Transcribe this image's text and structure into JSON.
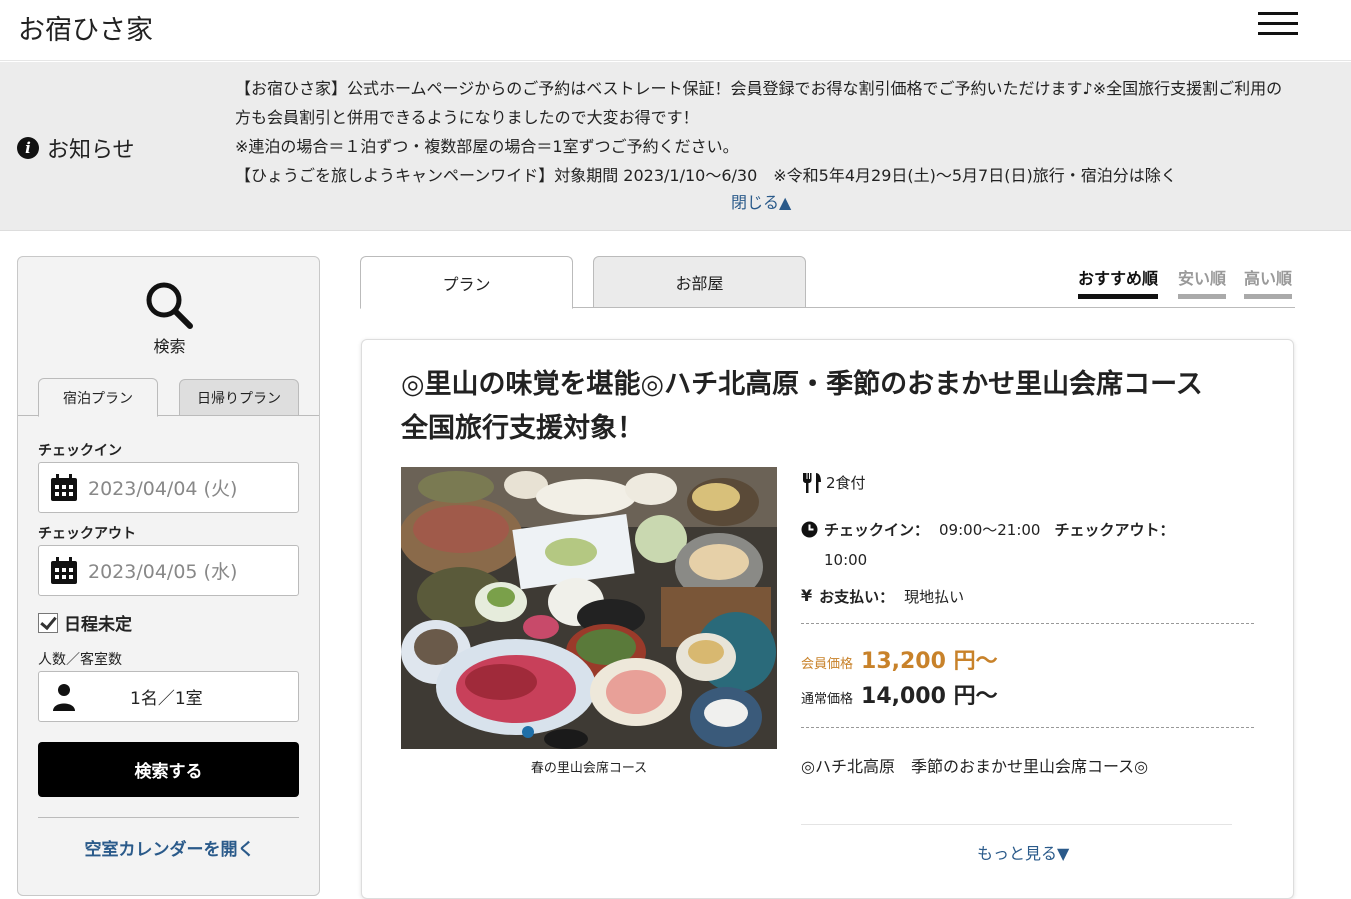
{
  "header": {
    "site_title": "お宿ひさ家",
    "menu_icon": "hamburger-menu-icon"
  },
  "notice": {
    "label": "お知らせ",
    "icon": "info-icon",
    "lines": [
      "【お宿ひさ家】公式ホームページからのご予約はベストレート保証！会員登録でお得な割引価格でご予約いただけます♪※全国旅行支援割ご利用の方も会員割引と併用できるようになりましたので大変お得です！",
      "※連泊の場合＝１泊ずつ・複数部屋の場合＝1室ずつご予約ください。",
      "【ひょうごを旅しようキャンペーンワイド】対象期間 2023/1/10～6/30　※令和5年4月29日(土)～5月7日(日)旅行・宿泊分は除く"
    ],
    "close_label": "閉じる▲"
  },
  "search": {
    "icon": "search-icon",
    "label": "検索",
    "tabs": [
      {
        "label": "宿泊プラン",
        "active": true
      },
      {
        "label": "日帰りプラン",
        "active": false
      }
    ],
    "checkin_label": "チェックイン",
    "checkin_value": "2023/04/04 (火)",
    "checkout_label": "チェックアウト",
    "checkout_value": "2023/04/05 (水)",
    "undecided_label": "日程未定",
    "undecided_checked": true,
    "guests_label": "人数／客室数",
    "guests_value": "1名／1室",
    "submit_label": "検索する",
    "calendar_link": "空室カレンダーを開く"
  },
  "main": {
    "tabs": [
      {
        "label": "プラン",
        "active": true
      },
      {
        "label": "お部屋",
        "active": false
      }
    ],
    "sort": [
      {
        "label": "おすすめ順",
        "active": true
      },
      {
        "label": "安い順",
        "active": false
      },
      {
        "label": "高い順",
        "active": false
      }
    ]
  },
  "plan": {
    "title": "◎里山の味覚を堪能◎ハチ北高原・季節のおまかせ里山会席コース　全国旅行支援対象！",
    "photo_caption": "春の里山会席コース",
    "meals": "2食付",
    "checkin_label": "チェックイン：",
    "checkin_time": "09:00～21:00",
    "checkout_label": "チェックアウト：",
    "checkout_time": "10:00",
    "payment_label": "お支払い：",
    "payment_value": "現地払い",
    "member_price_label": "会員価格",
    "member_price": "13,200 円～",
    "regular_price_label": "通常価格",
    "regular_price": "14,000 円～",
    "description": "◎ハチ北高原　季節のおまかせ里山会席コース◎",
    "more_label": "もっと見る▼"
  },
  "colors": {
    "accent_link": "#2a5a8a",
    "member_price": "#c8822a",
    "notice_bg": "#ececec"
  }
}
